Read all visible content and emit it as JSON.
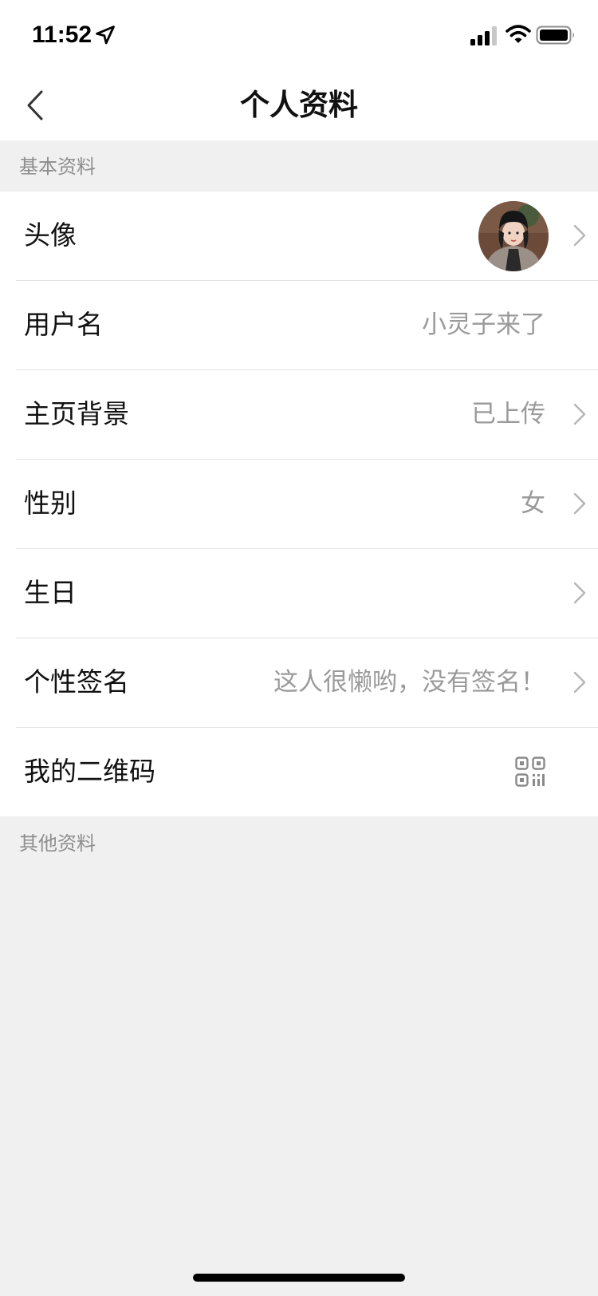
{
  "status_bar": {
    "time": "11:52",
    "icons": [
      "location-arrow-icon",
      "cellular-signal-icon",
      "wifi-icon",
      "battery-icon"
    ]
  },
  "nav": {
    "title": "个人资料",
    "back_icon": "chevron-left-icon"
  },
  "sections": {
    "basic": "基本资料",
    "other": "其他资料"
  },
  "rows": [
    {
      "label": "头像",
      "value": "",
      "type": "avatar"
    },
    {
      "label": "用户名",
      "value": "小灵子来了"
    },
    {
      "label": "主页背景",
      "value": "已上传"
    },
    {
      "label": "性别",
      "value": "女"
    },
    {
      "label": "生日",
      "value": ""
    },
    {
      "label": "个性签名",
      "value": "这人很懒哟，没有签名！"
    },
    {
      "label": "我的二维码",
      "value": "",
      "type": "qr-code"
    }
  ],
  "colors": {
    "background": "#f0f0f0",
    "card": "#ffffff",
    "label": "#111111",
    "value": "#9a9a9a",
    "section_header": "#8e8e8e",
    "divider": "#e3e3e3"
  }
}
